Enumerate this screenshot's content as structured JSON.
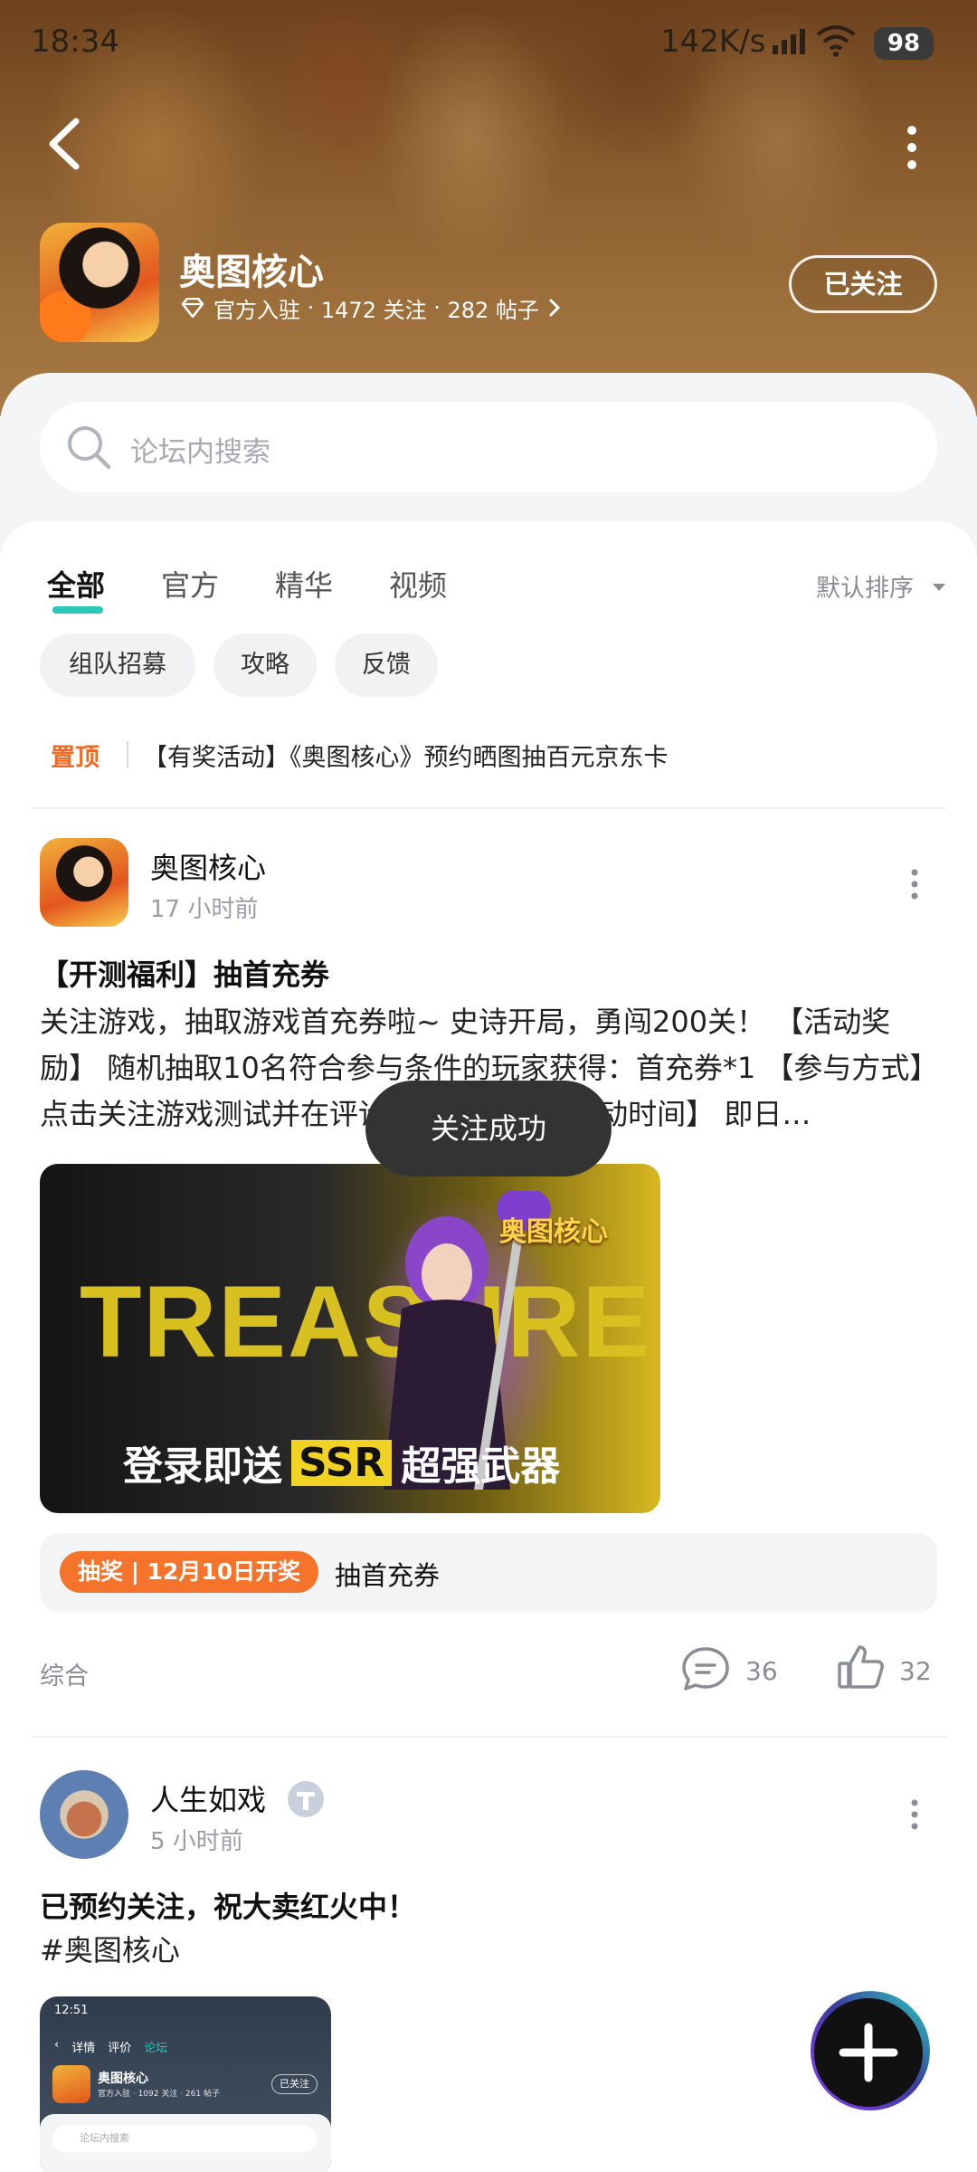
{
  "status_bar": {
    "time": "18:34",
    "net_speed": "142K/s",
    "battery": "98"
  },
  "header": {
    "forum_title": "奥图核心",
    "meta_prefix": "官方入驻",
    "followers": "1472 关注",
    "posts": "282 帖子",
    "follow_button": "已关注",
    "search_placeholder": "论坛内搜索"
  },
  "tabs": [
    {
      "label": "全部",
      "active": true
    },
    {
      "label": "官方",
      "active": false
    },
    {
      "label": "精华",
      "active": false
    },
    {
      "label": "视频",
      "active": false
    }
  ],
  "sort_label": "默认排序",
  "chips": [
    "组队招募",
    "攻略",
    "反馈"
  ],
  "pinned": {
    "tag": "置顶",
    "text": "【有奖活动】《奥图核心》预约晒图抽百元京东卡"
  },
  "posts": [
    {
      "author": "奥图核心",
      "time": "17 小时前",
      "title": "【开测福利】抽首充券",
      "body": "关注游戏，抽取游戏首充券啦~ 史诗开局，勇闯200关！ 【活动奖励】 随机抽取10名符合参与条件的玩家获得：首充券*1 【参与方式】 点击关注游戏测试并在评论区留言即可 【活动时间】 即日…",
      "image_title": "TREASURE",
      "image_caption": "登录即送",
      "image_caption_ssr": "SSR",
      "image_caption_tail": "超强武器",
      "image_logo": "奥图核心",
      "lottery_badge": "抽奖 | 12月10日开奖",
      "lottery_text": "抽首充券",
      "tag": "综合",
      "comments": "36",
      "likes": "32"
    },
    {
      "author": "人生如戏",
      "time": "5 小时前",
      "title": "已预约关注，祝大卖红火中！",
      "body": "#奥图核心",
      "thumb": {
        "time": "12:51",
        "tabs": [
          "详情",
          "评价",
          "论坛"
        ],
        "title": "奥图核心",
        "meta": "官方入驻 · 1092 关注 · 261 帖子",
        "follow": "已关注",
        "search": "论坛内搜索"
      }
    }
  ],
  "toast": "关注成功",
  "colors": {
    "accent": "#2ac7b8",
    "pinned": "#f06a22",
    "lottery": "#f5732b"
  }
}
